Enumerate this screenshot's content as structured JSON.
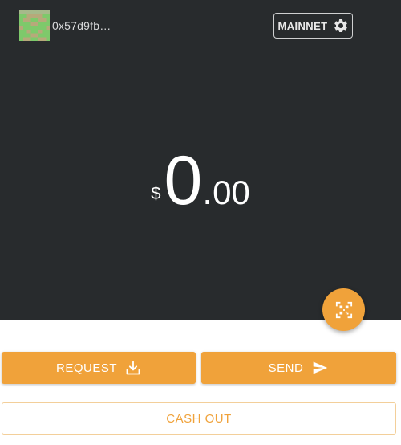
{
  "header": {
    "account": {
      "address": "0x57d9fb…",
      "avatar_icon": "identicon-avatar"
    },
    "network": {
      "label": "MAINNET",
      "icon": "gear-icon"
    }
  },
  "balance": {
    "currency_symbol": "$",
    "whole": "0",
    "separator": ".",
    "decimals": "00"
  },
  "scan_button": {
    "icon": "qr-code-icon"
  },
  "actions": {
    "request_label": "REQUEST",
    "request_icon": "download-icon",
    "send_label": "SEND",
    "send_icon": "send-arrow-icon",
    "cashout_label": "CASH OUT"
  },
  "colors": {
    "background_dark": "#282b2d",
    "accent": "#f0a23a",
    "avatar_primary": "#7ec96b",
    "avatar_secondary": "#b7a97a"
  }
}
